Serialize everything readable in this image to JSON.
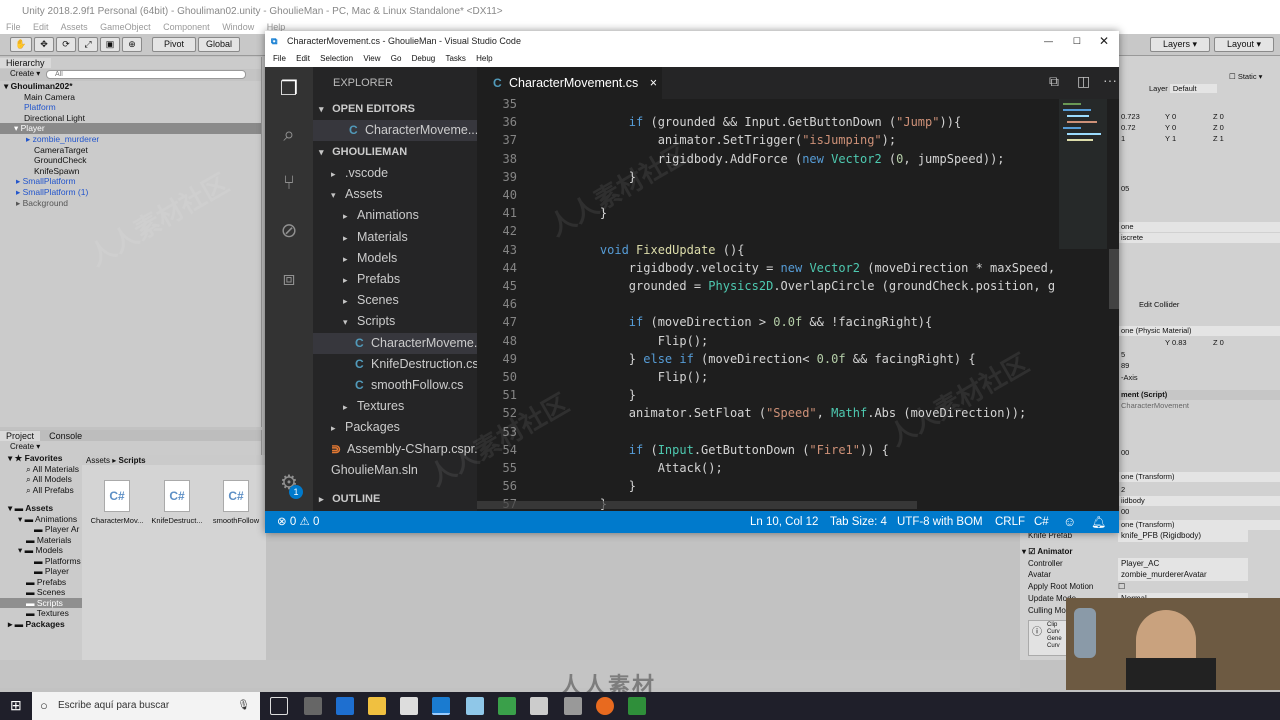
{
  "unity": {
    "title": "Unity 2018.2.9f1 Personal (64bit) - Ghouliman02.unity - GhoulieMan - PC, Mac & Linux Standalone* <DX11>",
    "menu": [
      "File",
      "Edit",
      "Assets",
      "GameObject",
      "Component",
      "Window",
      "Help"
    ],
    "toolbar": {
      "pivot": "Pivot",
      "global": "Global",
      "layers": "Layers",
      "layout": "Layout"
    },
    "hierarchy": {
      "tab": "Hierarchy",
      "create": "Create",
      "search_placeholder": "All",
      "items": [
        "Ghouliman202*",
        "Main Camera",
        "Platform",
        "Directional Light",
        "Player",
        "zombie_murderer",
        "CameraTarget",
        "GroundCheck",
        "KnifeSpawn",
        "SmallPlatform",
        "SmallPlatform (1)",
        "Background"
      ]
    },
    "project": {
      "tab": "Project",
      "console_tab": "Console",
      "create": "Create",
      "breadcrumb_root": "Assets",
      "breadcrumb_current": "Scripts",
      "favorites": [
        "Favorites",
        "All Materials",
        "All Models",
        "All Prefabs"
      ],
      "tree": [
        "Assets",
        "Animations",
        "Player Ar",
        "Materials",
        "Models",
        "Platforms",
        "Player",
        "Prefabs",
        "Scenes",
        "Scripts",
        "Textures",
        "Packages"
      ],
      "assets": [
        {
          "icon": "C#",
          "name": "CharacterMov..."
        },
        {
          "icon": "C#",
          "name": "KnifeDestruct..."
        },
        {
          "icon": "C#",
          "name": "smoothFollow"
        }
      ]
    },
    "inspector": {
      "static": "Static",
      "layer_label": "Layer",
      "layer_value": "Default",
      "rows": [
        "0.723",
        "0.72",
        "1",
        "05",
        "one",
        "iscrete",
        "Edit Collider",
        "one (Physic Material)",
        "0.83",
        "5",
        "89",
        "-Axis",
        "ment (Script)",
        "CharacterMovement",
        "00",
        "one (Transform)",
        "2",
        "iidbody",
        "00",
        "one (Transform)"
      ],
      "transform": {
        "y1": "0",
        "z1": "0",
        "y2": "0",
        "z2": "0",
        "y3": "1",
        "z3": "1",
        "y4": "0.83",
        "z4": "0"
      },
      "knife_prefab_label": "Knife Prefab",
      "knife_prefab_value": "knife_PFB (Rigidbody)",
      "animator": "Animator",
      "controller_label": "Controller",
      "controller_value": "Player_AC",
      "avatar_label": "Avatar",
      "avatar_value": "zombie_murdererAvatar",
      "apply_root_motion": "Apply Root Motion",
      "update_mode": "Update Mode",
      "update_value": "Normal",
      "culling_mode": "Culling Mo",
      "clip_info": [
        "Clip",
        "Curv",
        "Gene",
        "Curv",
        "(0.0"
      ]
    }
  },
  "vscode": {
    "window_title": "CharacterMovement.cs - GhoulieMan - Visual Studio Code",
    "menu": [
      "File",
      "Edit",
      "Selection",
      "View",
      "Go",
      "Debug",
      "Tasks",
      "Help"
    ],
    "explorer_title": "EXPLORER",
    "open_editors": "OPEN EDITORS",
    "open_file": "CharacterMoveme...",
    "project": "GHOULIEMAN",
    "tree": [
      {
        "label": ".vscode",
        "depth": 1,
        "type": "folder",
        "open": false
      },
      {
        "label": "Assets",
        "depth": 1,
        "type": "folder",
        "open": true
      },
      {
        "label": "Animations",
        "depth": 2,
        "type": "folder",
        "open": false
      },
      {
        "label": "Materials",
        "depth": 2,
        "type": "folder",
        "open": false
      },
      {
        "label": "Models",
        "depth": 2,
        "type": "folder",
        "open": false
      },
      {
        "label": "Prefabs",
        "depth": 2,
        "type": "folder",
        "open": false
      },
      {
        "label": "Scenes",
        "depth": 2,
        "type": "folder",
        "open": false
      },
      {
        "label": "Scripts",
        "depth": 2,
        "type": "folder",
        "open": true
      },
      {
        "label": "CharacterMoveme...",
        "depth": 3,
        "type": "cs",
        "selected": true
      },
      {
        "label": "KnifeDestruction.cs",
        "depth": 3,
        "type": "cs"
      },
      {
        "label": "smoothFollow.cs",
        "depth": 3,
        "type": "cs"
      },
      {
        "label": "Textures",
        "depth": 2,
        "type": "folder",
        "open": false
      },
      {
        "label": "Packages",
        "depth": 1,
        "type": "folder",
        "open": false
      },
      {
        "label": "Assembly-CSharp.cspr...",
        "depth": 1,
        "type": "rss"
      },
      {
        "label": "GhoulieMan.sln",
        "depth": 1,
        "type": "sln"
      }
    ],
    "outline": "OUTLINE",
    "badge": "1",
    "tab": {
      "name": "CharacterMovement.cs",
      "close": "×"
    },
    "code": [
      {
        "n": "35",
        "t": []
      },
      {
        "n": "36",
        "t": [
          [
            "pl",
            "        "
          ],
          [
            "kw",
            "if"
          ],
          [
            "pl",
            " (grounded && Input.GetButtonDown ("
          ],
          [
            "st",
            "\"Jump\""
          ],
          [
            "pl",
            "))"
          ],
          [
            "pl",
            "{"
          ]
        ]
      },
      {
        "n": "37",
        "t": [
          [
            "pl",
            "            animator.SetTrigger("
          ],
          [
            "st",
            "\"isJumping\""
          ],
          [
            "pl",
            ");"
          ]
        ]
      },
      {
        "n": "38",
        "t": [
          [
            "pl",
            "            rigidbody.AddForce ("
          ],
          [
            "kw",
            "new"
          ],
          [
            "pl",
            " "
          ],
          [
            "ty",
            "Vector2"
          ],
          [
            "pl",
            " ("
          ],
          [
            "nm",
            "0"
          ],
          [
            "pl",
            ", jumpSpeed));"
          ]
        ]
      },
      {
        "n": "39",
        "t": [
          [
            "pl",
            "        }"
          ]
        ]
      },
      {
        "n": "40",
        "t": []
      },
      {
        "n": "41",
        "t": [
          [
            "pl",
            "    }"
          ]
        ]
      },
      {
        "n": "42",
        "t": []
      },
      {
        "n": "43",
        "t": [
          [
            "pl",
            "    "
          ],
          [
            "kw",
            "void"
          ],
          [
            "pl",
            " "
          ],
          [
            "fn",
            "FixedUpdate"
          ],
          [
            "pl",
            " (){"
          ]
        ]
      },
      {
        "n": "44",
        "t": [
          [
            "pl",
            "        rigidbody.velocity = "
          ],
          [
            "kw",
            "new"
          ],
          [
            "pl",
            " "
          ],
          [
            "ty",
            "Vector2"
          ],
          [
            "pl",
            " (moveDirection * maxSpeed, ri"
          ]
        ]
      },
      {
        "n": "45",
        "t": [
          [
            "pl",
            "        grounded = "
          ],
          [
            "ty",
            "Physics2D"
          ],
          [
            "pl",
            ".OverlapCircle (groundCheck.position, grou"
          ]
        ]
      },
      {
        "n": "46",
        "t": []
      },
      {
        "n": "47",
        "t": [
          [
            "pl",
            "        "
          ],
          [
            "kw",
            "if"
          ],
          [
            "pl",
            " (moveDirection > "
          ],
          [
            "nm",
            "0.0f"
          ],
          [
            "pl",
            " && !facingRight){"
          ]
        ]
      },
      {
        "n": "48",
        "t": [
          [
            "pl",
            "            Flip();"
          ]
        ]
      },
      {
        "n": "49",
        "t": [
          [
            "pl",
            "        } "
          ],
          [
            "kw",
            "else if"
          ],
          [
            "pl",
            " (moveDirection< "
          ],
          [
            "nm",
            "0.0f"
          ],
          [
            "pl",
            " && facingRight) {"
          ]
        ]
      },
      {
        "n": "50",
        "t": [
          [
            "pl",
            "            Flip();"
          ]
        ]
      },
      {
        "n": "51",
        "t": [
          [
            "pl",
            "        }"
          ]
        ]
      },
      {
        "n": "52",
        "t": [
          [
            "pl",
            "        animator.SetFloat ("
          ],
          [
            "st",
            "\"Speed\""
          ],
          [
            "pl",
            ", "
          ],
          [
            "ty",
            "Mathf"
          ],
          [
            "pl",
            ".Abs (moveDirection));"
          ]
        ]
      },
      {
        "n": "53",
        "t": []
      },
      {
        "n": "54",
        "t": [
          [
            "pl",
            "        "
          ],
          [
            "kw",
            "if"
          ],
          [
            "pl",
            " ("
          ],
          [
            "ty",
            "Input"
          ],
          [
            "pl",
            ".GetButtonDown ("
          ],
          [
            "st",
            "\"Fire1\""
          ],
          [
            "pl",
            ")) {"
          ]
        ]
      },
      {
        "n": "55",
        "t": [
          [
            "pl",
            "            Attack();"
          ]
        ]
      },
      {
        "n": "56",
        "t": [
          [
            "pl",
            "        }"
          ]
        ]
      },
      {
        "n": "57",
        "t": [
          [
            "pl",
            "    }"
          ]
        ]
      }
    ],
    "status": {
      "errors": "0",
      "warnings": "0",
      "position": "Ln 10, Col 12",
      "tab_size": "Tab Size: 4",
      "encoding": "UTF-8 with BOM",
      "eol": "CRLF",
      "language": "C#"
    }
  },
  "taskbar": {
    "search_placeholder": "Escribe aquí para buscar"
  },
  "watermarks": [
    "人人素材社区",
    "人人素材社区",
    "人人素材社区",
    "人人素材社区"
  ],
  "logo": "人人素材"
}
